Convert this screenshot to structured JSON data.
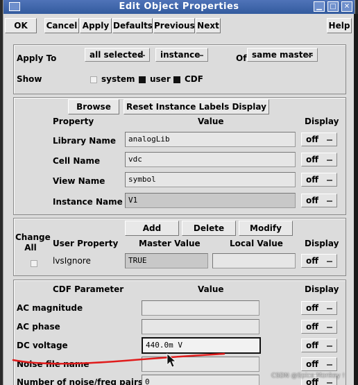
{
  "window": {
    "title": "Edit Object Properties"
  },
  "toolbar": {
    "ok": "OK",
    "cancel": "Cancel",
    "apply": "Apply",
    "defaults": "Defaults",
    "previous": "Previous",
    "next": "Next",
    "help": "Help"
  },
  "apply_section": {
    "apply_to_label": "Apply To",
    "apply_to_value": "all selected",
    "apply_type_value": "instance",
    "of_label": "Of",
    "of_value": "same master",
    "show_label": "Show",
    "show_options": [
      {
        "label": "system",
        "checked": false
      },
      {
        "label": "user",
        "checked": true
      },
      {
        "label": "CDF",
        "checked": true
      }
    ]
  },
  "properties": {
    "browse_label": "Browse",
    "reset_label": "Reset Instance Labels Display",
    "headers": {
      "property": "Property",
      "value": "Value",
      "display": "Display"
    },
    "rows": [
      {
        "label": "Library Name",
        "value": "analogLib",
        "display": "off"
      },
      {
        "label": "Cell Name",
        "value": "vdc",
        "display": "off"
      },
      {
        "label": "View Name",
        "value": "symbol",
        "display": "off"
      },
      {
        "label": "Instance Name",
        "value": "V1",
        "display": "off"
      }
    ]
  },
  "user_props": {
    "add_label": "Add",
    "delete_label": "Delete",
    "modify_label": "Modify",
    "change_all_label": "Change All",
    "headers": {
      "user_property": "User Property",
      "master_value": "Master Value",
      "local_value": "Local Value",
      "display": "Display"
    },
    "rows": [
      {
        "label": "lvsIgnore",
        "master_value": "TRUE",
        "local_value": "",
        "display": "off"
      }
    ]
  },
  "cdf": {
    "headers": {
      "parameter": "CDF Parameter",
      "value": "Value",
      "display": "Display"
    },
    "rows": [
      {
        "label": "AC magnitude",
        "value": "",
        "display": "off"
      },
      {
        "label": "AC phase",
        "value": "",
        "display": "off"
      },
      {
        "label": "DC voltage",
        "value": "440.0m V",
        "display": "off"
      },
      {
        "label": "Noise file name",
        "value": "",
        "display": "off"
      },
      {
        "label": "Number of noise/freq pairs",
        "value": "0",
        "display": "off"
      }
    ]
  },
  "watermark": "CSDN @Spice Monkey !",
  "colors": {
    "titlebar": "#3d65ad",
    "annotation": "#e01c1c"
  }
}
